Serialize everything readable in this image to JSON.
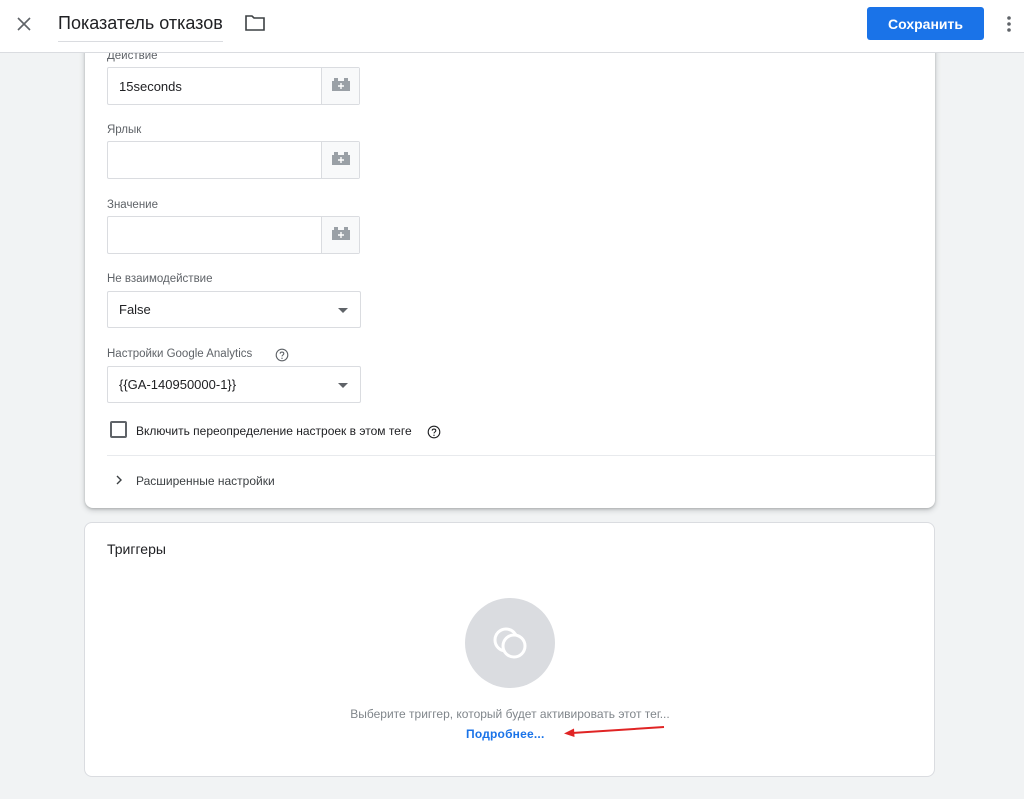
{
  "header": {
    "title": "Показатель отказов",
    "save_label": "Сохранить"
  },
  "fields": {
    "action": {
      "label": "Действие",
      "value": "15seconds"
    },
    "label_field": {
      "label": "Ярлык",
      "value": ""
    },
    "value_field": {
      "label": "Значение",
      "value": ""
    },
    "non_interaction": {
      "label": "Не взаимодействие",
      "value": "False"
    },
    "ga_settings": {
      "label": "Настройки Google Analytics",
      "value": "{{GA-140950000-1}}"
    }
  },
  "override_checkbox": {
    "label": "Включить переопределение настроек в этом теге",
    "checked": false
  },
  "advanced": {
    "label": "Расширенные настройки"
  },
  "triggers": {
    "title": "Триггеры",
    "hint": "Выберите триггер, который будет активировать этот тег...",
    "link": "Подробнее..."
  },
  "colors": {
    "accent": "#1a73e8",
    "annotation_arrow": "#e02424"
  },
  "icons": [
    "close-icon",
    "folder-icon",
    "more-vert-icon",
    "variable-icon",
    "help-icon",
    "chevron-right-icon",
    "trigger-icon",
    "arrow-annotation"
  ]
}
